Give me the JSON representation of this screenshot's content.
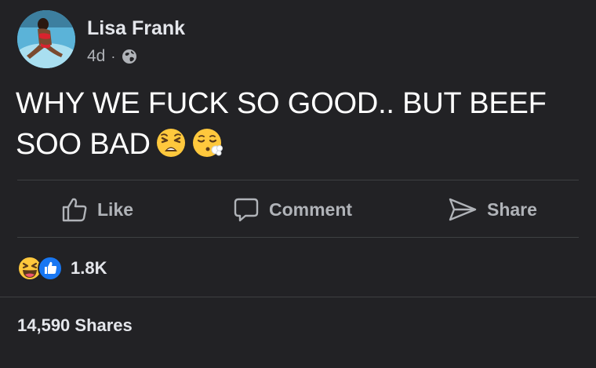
{
  "author": {
    "name": "Lisa Frank",
    "time": "4d",
    "separator": "·",
    "privacy_icon": "globe-icon"
  },
  "post": {
    "text": "WHY WE FUCK SO GOOD.. BUT BEEF SOO BAD",
    "emojis": [
      "weary-face-emoji",
      "face-exhaling-emoji"
    ]
  },
  "actions": {
    "like": "Like",
    "comment": "Comment",
    "share": "Share"
  },
  "reactions": {
    "icons": [
      "laughing-face-icon",
      "thumbs-up-icon"
    ],
    "count": "1.8K"
  },
  "shares": "14,590 Shares",
  "colors": {
    "background": "#222225",
    "text_primary": "#e4e6eb",
    "text_secondary": "#b0b3b8",
    "like_blue": "#1877f2",
    "emoji_yellow": "#ffc83d"
  }
}
